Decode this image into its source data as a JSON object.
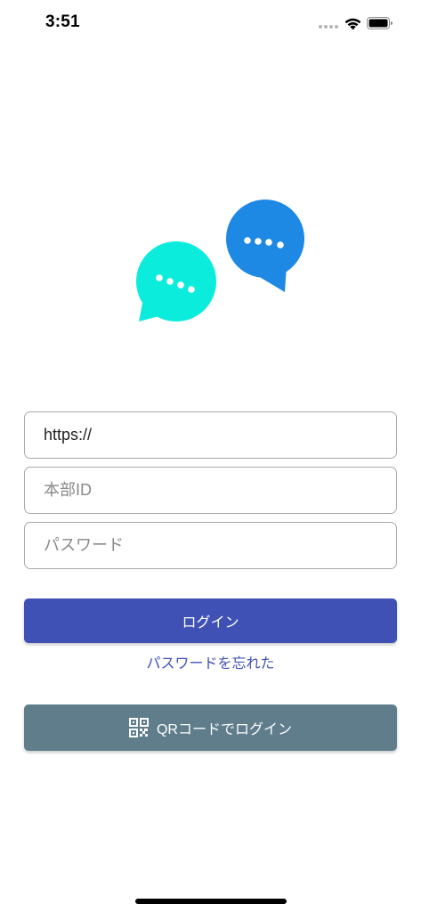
{
  "status_bar": {
    "time": "3:51"
  },
  "logo": {
    "bubble_left_color": "#0cecdd",
    "bubble_right_color": "#1e88e5",
    "dot_color": "#ffffff"
  },
  "form": {
    "url_value": "https://",
    "url_placeholder": "",
    "hq_id_placeholder": "本部ID",
    "password_placeholder": "パスワード"
  },
  "buttons": {
    "login_label": "ログイン",
    "forgot_password_label": "パスワードを忘れた",
    "qr_login_label": "QRコードでログイン"
  },
  "colors": {
    "login_button": "#3f51b5",
    "qr_button": "#607d8b",
    "link": "#3f51b5"
  },
  "icons": {
    "qr": "qr-code-icon",
    "wifi": "wifi-icon",
    "battery": "battery-icon",
    "signal": "cellular-signal-icon"
  }
}
